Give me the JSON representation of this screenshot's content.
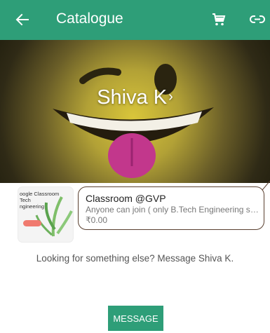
{
  "appbar": {
    "title": "Catalogue",
    "back_icon": "arrow-left-icon",
    "cart_icon": "cart-icon",
    "link_icon": "link-icon",
    "background": "#2e9e78"
  },
  "hero": {
    "name": "Shiva K",
    "chevron": "›"
  },
  "product": {
    "name": "Classroom @GVP",
    "description": "Anyone can join ( only B.Tech Engineering students )",
    "price": "₹0.00",
    "thumb_text": "oogle Classroom\nTech\nngineering"
  },
  "footer": {
    "looking_text": "Looking for something else? Message Shiva K.",
    "message_button": "MESSAGE"
  }
}
